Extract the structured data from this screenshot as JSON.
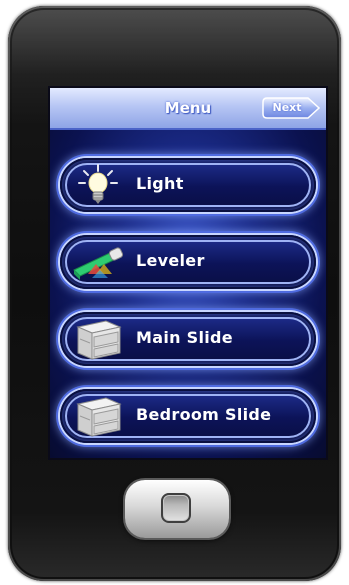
{
  "header": {
    "title": "Menu",
    "next_label": "Next"
  },
  "menu": {
    "items": [
      {
        "label": "Light",
        "icon": "lightbulb-icon"
      },
      {
        "label": "Leveler",
        "icon": "leveler-icon"
      },
      {
        "label": "Main Slide",
        "icon": "slide-cabinet-icon"
      },
      {
        "label": "Bedroom Slide",
        "icon": "slide-cabinet-icon"
      }
    ]
  },
  "colors": {
    "screen": "#1a2a86",
    "header": "#b7c6f4",
    "button_glow": "#c8d6ff",
    "device": "#0e0e0e"
  },
  "device": {
    "home_button_icon": "home-button-icon"
  }
}
